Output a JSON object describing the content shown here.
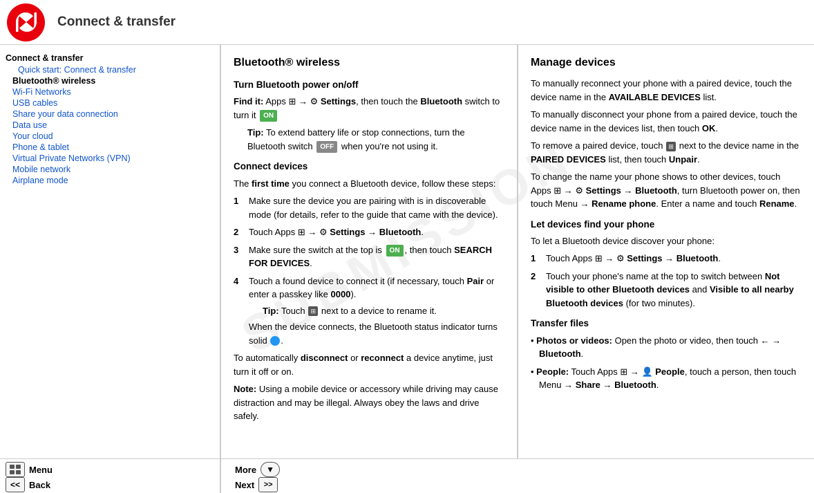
{
  "header": {
    "title": "Connect & transfer"
  },
  "sidebar": {
    "section": "Connect & transfer",
    "items": [
      {
        "label": "Quick start: Connect & transfer",
        "indent": true,
        "current": false
      },
      {
        "label": "Bluetooth® wireless",
        "indent": false,
        "current": true
      },
      {
        "label": "Wi-Fi Networks",
        "indent": false,
        "current": false
      },
      {
        "label": "USB cables",
        "indent": false,
        "current": false
      },
      {
        "label": "Share your data connection",
        "indent": false,
        "current": false
      },
      {
        "label": "Data use",
        "indent": false,
        "current": false
      },
      {
        "label": "Your cloud",
        "indent": false,
        "current": false
      },
      {
        "label": "Phone & tablet",
        "indent": false,
        "current": false
      },
      {
        "label": "Virtual Private Networks (VPN)",
        "indent": false,
        "current": false
      },
      {
        "label": "Mobile network",
        "indent": false,
        "current": false
      },
      {
        "label": "Airplane mode",
        "indent": false,
        "current": false
      }
    ]
  },
  "middle": {
    "section_title": "Bluetooth® wireless",
    "subsection1": "Turn Bluetooth power on/off",
    "find_it_label": "Find it:",
    "find_it_text": "Apps",
    "find_it_text2": "Settings",
    "find_it_text3": "then touch the",
    "find_it_text4": "Bluetooth",
    "find_it_text5": "switch to turn it",
    "on_badge": "ON",
    "tip1_label": "Tip:",
    "tip1_text": "To extend battery life or stop connections, turn the Bluetooth switch",
    "off_badge": "OFF",
    "tip1_text2": "when you're not using it.",
    "subsection2": "Connect devices",
    "connect_intro": "The",
    "connect_first_time": "first time",
    "connect_intro2": "you connect a Bluetooth device, follow these steps:",
    "steps": [
      {
        "num": "1",
        "text": "Make sure the device you are pairing with is in discoverable mode (for details, refer to the guide that came with the device)."
      },
      {
        "num": "2",
        "text": "Touch Apps  →  Settings → Bluetooth."
      },
      {
        "num": "3",
        "text": "Make sure the switch at the top is",
        "on_badge": "ON",
        "text2": ", then touch SEARCH FOR DEVICES."
      },
      {
        "num": "4",
        "text": "Touch a found device to connect it (if necessary, touch",
        "bold": "Pair",
        "text2": "or enter a passkey like",
        "bold2": "0000",
        "text3": ").",
        "tip_label": "Tip:",
        "tip_text": "Touch",
        "tip_text2": "next to a device to rename it.",
        "note_text": "When the device connects, the Bluetooth status indicator turns solid"
      }
    ],
    "auto_label": "To automatically",
    "auto_disconnect": "disconnect",
    "auto_or": "or",
    "auto_reconnect": "reconnect",
    "auto_text": "a device anytime, just turn it off or on.",
    "note_label": "Note:",
    "note_text": "Using a mobile device or accessory while driving may cause distraction and may be illegal. Always obey the laws and drive safely."
  },
  "right": {
    "section1_title": "Manage devices",
    "manage_text1": "To manually reconnect your phone with a paired device, touch the device name in the",
    "manage_bold1": "AVAILABLE DEVICES",
    "manage_text1b": "list.",
    "manage_text2": "To manually disconnect your phone from a paired device, touch the device name in the devices list, then touch",
    "manage_bold2": "OK",
    "manage_text2b": ".",
    "manage_text3": "To remove a paired device, touch",
    "manage_text3b": "next to the device name in the",
    "manage_bold3": "PAIRED DEVICES",
    "manage_text3c": "list, then touch",
    "manage_bold3b": "Unpair",
    "manage_text3d": ".",
    "manage_text4": "To change the name your phone shows to other devices, touch Apps",
    "manage_text4b": "→",
    "manage_bold4": "Settings → Bluetooth",
    "manage_text4c": ", turn Bluetooth power on, then touch Menu",
    "manage_text4d": "→",
    "manage_bold4b": "Rename phone",
    "manage_text4e": ". Enter a name and touch",
    "manage_bold4c": "Rename",
    "manage_text4f": ".",
    "section2_title": "Let devices find your phone",
    "let_text": "To let a Bluetooth device discover your phone:",
    "let_steps": [
      {
        "num": "1",
        "text": "Touch Apps",
        "text2": "→",
        "bold": "Settings → Bluetooth",
        "text3": "."
      },
      {
        "num": "2",
        "text": "Touch your phone's name at the top to switch between",
        "bold1": "Not visible to other Bluetooth devices",
        "text2": "and",
        "bold2": "Visible to all nearby Bluetooth devices",
        "text3": "(for two minutes)."
      }
    ],
    "section3_title": "Transfer files",
    "transfer_items": [
      {
        "label": "Photos or videos:",
        "text": "Open the photo or video, then touch",
        "arrow": "→",
        "bold": "Bluetooth",
        "text2": "."
      },
      {
        "label": "People:",
        "text": "Touch Apps",
        "arrow1": "→",
        "bold1": "People",
        "text2": ", touch a person, then touch Menu",
        "arrow2": "→",
        "bold2": "Share → Bluetooth",
        "text3": "."
      }
    ]
  },
  "footer": {
    "menu_label": "Menu",
    "more_label": "More",
    "back_label": "Back",
    "next_label": "Next"
  },
  "colors": {
    "accent_red": "#e8000d",
    "link_blue": "#1155cc",
    "on_green": "#4caf50",
    "off_gray": "#888888"
  }
}
